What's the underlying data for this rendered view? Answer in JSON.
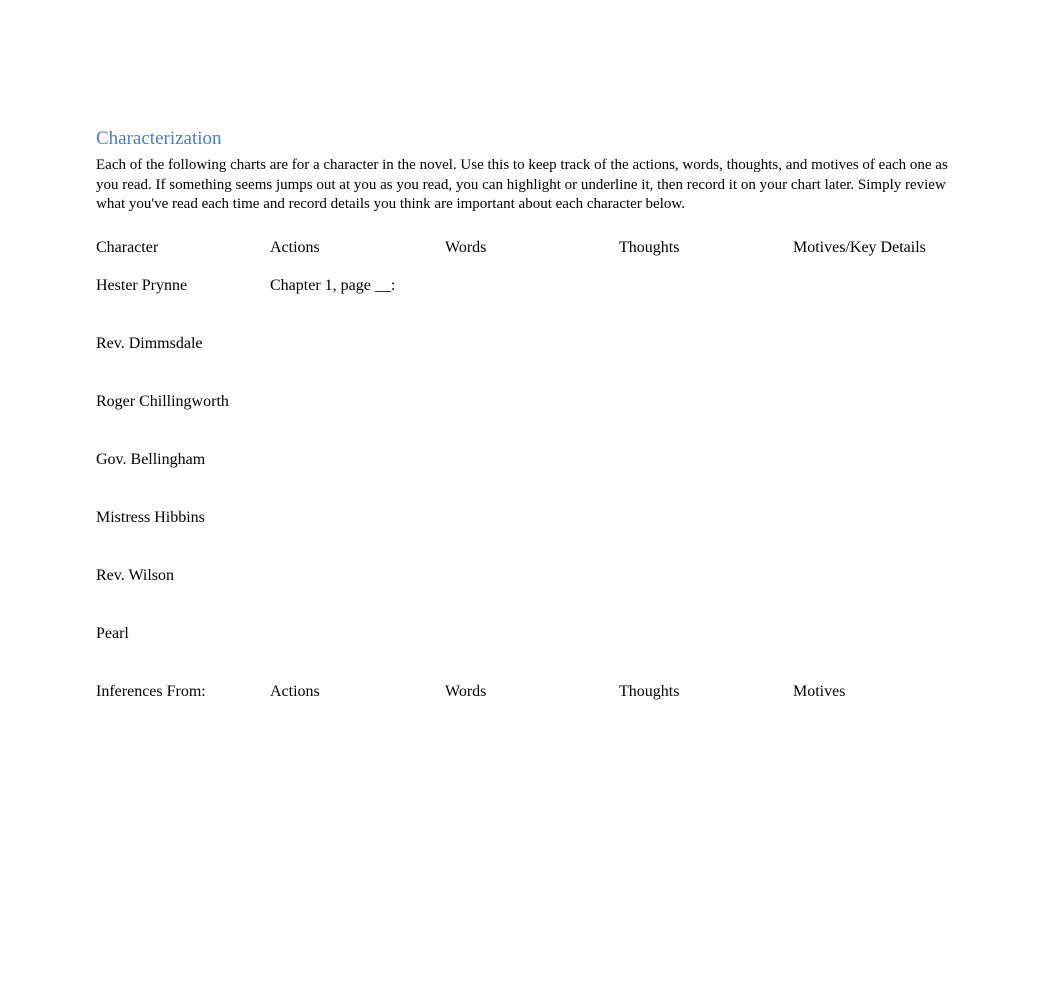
{
  "title": "Characterization",
  "intro": "Each of the following charts are for a character in the novel.   Use this to keep track of the actions, words, thoughts, and motives of each one as you read.  If something seems jumps out at you as you read, you can highlight or underline it, then record it on your chart later.      Simply review what you've read each time and record details you think are important about each character below.",
  "table1": {
    "headers": {
      "character": "Character",
      "actions": "Actions",
      "words": "Words",
      "thoughts": "Thoughts",
      "motives": "Motives/Key Details"
    },
    "rows": [
      {
        "character": "Hester Prynne",
        "actions": "Chapter 1, page __:",
        "words": "",
        "thoughts": "",
        "motives": ""
      },
      {
        "character": "Rev. Dimmsdale",
        "actions": "",
        "words": "",
        "thoughts": "",
        "motives": ""
      },
      {
        "character": "Roger Chillingworth",
        "actions": "",
        "words": "",
        "thoughts": "",
        "motives": ""
      },
      {
        "character": "Gov. Bellingham",
        "actions": "",
        "words": "",
        "thoughts": "",
        "motives": ""
      },
      {
        "character": "Mistress Hibbins",
        "actions": "",
        "words": "",
        "thoughts": "",
        "motives": ""
      },
      {
        "character": "Rev. Wilson",
        "actions": "",
        "words": "",
        "thoughts": "",
        "motives": ""
      },
      {
        "character": "Pearl",
        "actions": "",
        "words": "",
        "thoughts": "",
        "motives": ""
      }
    ]
  },
  "table2": {
    "headers": {
      "inferences": "Inferences From:",
      "actions": "Actions",
      "words": "Words",
      "thoughts": "Thoughts",
      "motives": "Motives"
    }
  }
}
